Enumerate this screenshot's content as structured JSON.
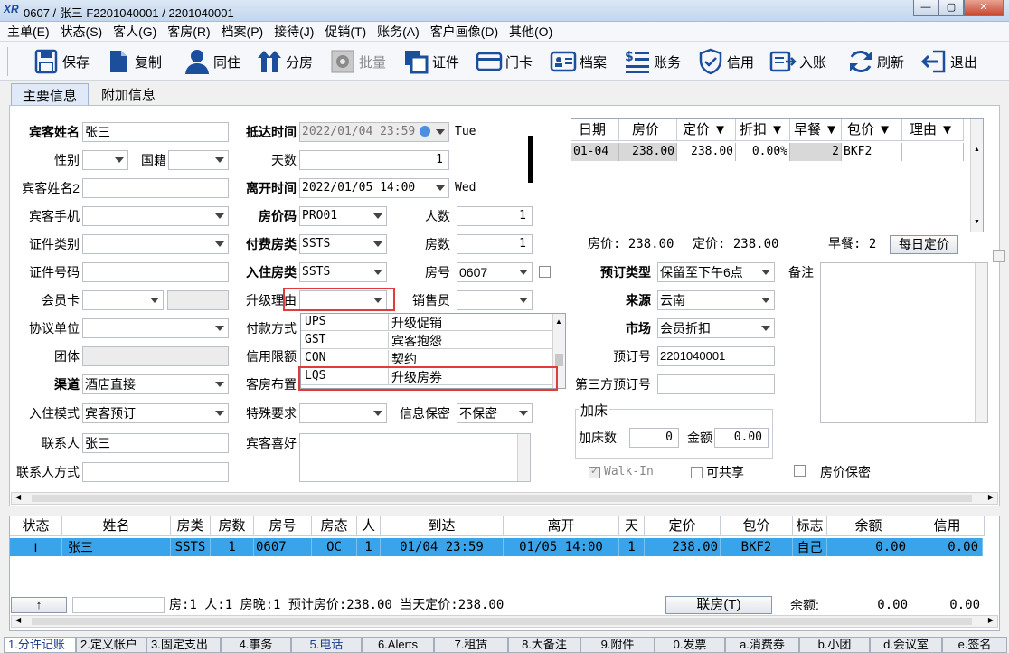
{
  "window": {
    "title": "0607 / 张三  F2201040001 / 2201040001",
    "min": "—",
    "max": "▢",
    "close": "✕",
    "logo": "XR"
  },
  "menu": [
    "主单(E)",
    "状态(S)",
    "客人(G)",
    "客房(R)",
    "档案(P)",
    "接待(J)",
    "促销(T)",
    "账务(A)",
    "客户画像(D)",
    "其他(O)"
  ],
  "toolbar": {
    "save": "保存",
    "copy": "复制",
    "cohabit": "同住",
    "split": "分房",
    "batch": "批量",
    "cert": "证件",
    "card": "门卡",
    "profile": "档案",
    "account": "账务",
    "credit": "信用",
    "checkin": "入账",
    "refresh": "刷新",
    "exit": "退出"
  },
  "tabs": {
    "main": "主要信息",
    "extra": "附加信息"
  },
  "guest": {
    "name_label": "宾客姓名",
    "name": "张三",
    "sex_label": "性别",
    "nation_label": "国籍",
    "name2_label": "宾客姓名2",
    "mobile_label": "宾客手机",
    "idtype_label": "证件类别",
    "idno_label": "证件号码",
    "member_label": "会员卡",
    "agreement_label": "协议单位",
    "group_label": "团体",
    "channel_label": "渠道",
    "channel": "酒店直接",
    "mode_label": "入住模式",
    "mode": "宾客预订",
    "contact_label": "联系人",
    "contact": "张三",
    "contact_way_label": "联系人方式"
  },
  "stay": {
    "arrive_label": "抵达时间",
    "arrive": "2022/01/04 23:59",
    "arrive_day": "Tue",
    "days_label": "天数",
    "days": "1",
    "leave_label": "离开时间",
    "leave": "2022/01/05 14:00",
    "leave_day": "Wed",
    "ratecode_label": "房价码",
    "ratecode": "PRO01",
    "persons_label": "人数",
    "persons": "1",
    "paytype_label": "付费房类",
    "paytype": "SSTS",
    "rooms_label": "房数",
    "rooms": "1",
    "roomtype_label": "入住房类",
    "roomtype": "SSTS",
    "roomno_label": "房号",
    "roomno": "0607",
    "upgrade_label": "升级理由",
    "upgrade": "",
    "seller_label": "销售员",
    "payment_label": "付款方式",
    "creditlimit_label": "信用限额",
    "layout_label": "客房布置",
    "special_label": "特殊要求",
    "secret_label": "信息保密",
    "secret": "不保密",
    "pref_label": "宾客喜好"
  },
  "upgrade_options": [
    {
      "code": "UPS",
      "name": "升级促销"
    },
    {
      "code": "GST",
      "name": "宾客抱怨"
    },
    {
      "code": "CON",
      "name": "契约"
    },
    {
      "code": "LQS",
      "name": "升级房券"
    }
  ],
  "booking": {
    "type_label": "预订类型",
    "type": "保留至下午6点",
    "source_label": "来源",
    "source": "云南",
    "market_label": "市场",
    "market": "会员折扣",
    "resno_label": "预订号",
    "resno": "2201040001",
    "third_label": "第三方预订号",
    "remark_label": "备注",
    "extra_bed_title": "加床",
    "extra_bed_label": "加床数",
    "extra_bed": "0",
    "amount_label": "金额",
    "amount": "0.00",
    "walkin": "Walk-In",
    "shareable": "可共享",
    "rate_secret": "房价保密"
  },
  "rate_table": {
    "headers": [
      "日期",
      "房价",
      "定价 ▼",
      "折扣 ▼",
      "早餐 ▼",
      "包价 ▼",
      "理由 ▼"
    ],
    "rows": [
      [
        "01-04",
        "238.00",
        "238.00",
        "0.00%",
        "2",
        "BKF2",
        ""
      ]
    ],
    "summary_rate": "房价: 238.00",
    "summary_fixed": "定价: 238.00",
    "summary_bf": "早餐: 2",
    "daily_btn": "每日定价"
  },
  "grid": {
    "headers": [
      "状态",
      "姓名",
      "房类",
      "房数",
      "房号",
      "房态",
      "人",
      "到达",
      "离开",
      "天",
      "定价",
      "包价",
      "标志",
      "余额",
      "信用"
    ],
    "row": [
      "I",
      "张三",
      "SSTS",
      "1",
      "0607",
      "OC",
      "1",
      "01/04 23:59",
      "01/05 14:00",
      "1",
      "238.00",
      "BKF2",
      "自己",
      "0.00",
      "0.00"
    ],
    "footer_arrow": "↑",
    "footer_text": "房:1   人:1   房晚:1   预计房价:238.00   当天定价:238.00",
    "link_btn": "联房(T)",
    "balance_label": "余额:",
    "balance": "0.00",
    "credit": "0.00"
  },
  "bottom_tabs": [
    "1.分许记账",
    "2.定义帐户",
    "3.固定支出",
    "4.事务",
    "5.电话",
    "6.Alerts",
    "7.租赁",
    "8.大备注",
    "9.附件",
    "0.发票",
    "a.消费券",
    "b.小团",
    "d.会议室",
    "e.签名"
  ]
}
